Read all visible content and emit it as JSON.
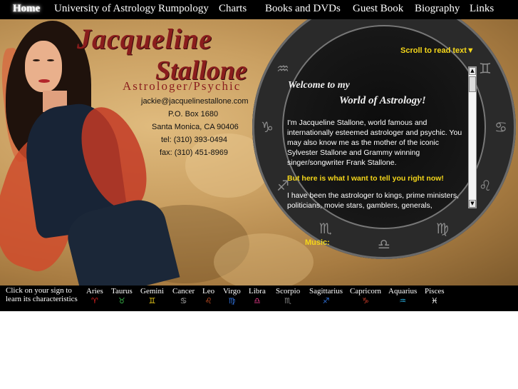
{
  "nav": {
    "items": [
      {
        "label": "Home"
      },
      {
        "label": "University of Astrology"
      },
      {
        "label": "Rumpology"
      },
      {
        "label": "Charts"
      },
      {
        "label": "Books and DVDs"
      },
      {
        "label": "Guest Book"
      },
      {
        "label": "Biography"
      },
      {
        "label": "Links"
      }
    ]
  },
  "header": {
    "name_line1": "Jacqueline",
    "name_line2": "Stallone",
    "subtitle": "Astrologer/Psychic"
  },
  "contact": {
    "email": "jackie@jacquelinestallone.com",
    "po_box": "P.O. Box 1680",
    "city": "Santa Monica, CA 90406",
    "tel": "tel: (310) 393-0494",
    "fax": "fax: (310) 451-8969"
  },
  "welcome": {
    "scroll_hint": "Scroll to read text▼",
    "line1": "Welcome to my",
    "line2": "World of Astrology!",
    "para1": "I'm Jacqueline Stallone, world famous and internationally esteemed astrologer and psychic. You may also know me as the mother of the iconic Sylvester Stallone and Grammy winning singer/songwriter Frank Stallone.",
    "para2": "But here is what I want to tell you right now!",
    "para3": "I have been the astrologer to kings, prime ministers, politicians, movie stars, gamblers, generals,"
  },
  "music": {
    "label": "Music:"
  },
  "zodiac_bar": {
    "prompt": "Click on your sign to learn its characteristics",
    "signs": [
      {
        "label": "Aries",
        "glyph": "♈",
        "color": "#e02020"
      },
      {
        "label": "Taurus",
        "glyph": "♉",
        "color": "#3ab54a"
      },
      {
        "label": "Gemini",
        "glyph": "♊",
        "color": "#f2d21b"
      },
      {
        "label": "Cancer",
        "glyph": "♋",
        "color": "#bbbbbb"
      },
      {
        "label": "Leo",
        "glyph": "♌",
        "color": "#f0602a"
      },
      {
        "label": "Virgo",
        "glyph": "♍",
        "color": "#2f6fd6"
      },
      {
        "label": "Libra",
        "glyph": "♎",
        "color": "#e83a8c"
      },
      {
        "label": "Scorpio",
        "glyph": "♏",
        "color": "#8c8c8c"
      },
      {
        "label": "Sagittarius",
        "glyph": "♐",
        "color": "#2f6fd6"
      },
      {
        "label": "Capricorn",
        "glyph": "♑",
        "color": "#d13e2a"
      },
      {
        "label": "Aquarius",
        "glyph": "♒",
        "color": "#2ab0e0"
      },
      {
        "label": "Pisces",
        "glyph": "♓",
        "color": "#ffffff"
      }
    ]
  },
  "wheel_glyphs": [
    "♈",
    "♉",
    "♊",
    "♋",
    "♌",
    "♍",
    "♎",
    "♏",
    "♐",
    "♑",
    "♒",
    "♓"
  ],
  "colors": {
    "accent_yellow": "#f4d61a",
    "title_red": "#8a1d1d"
  }
}
